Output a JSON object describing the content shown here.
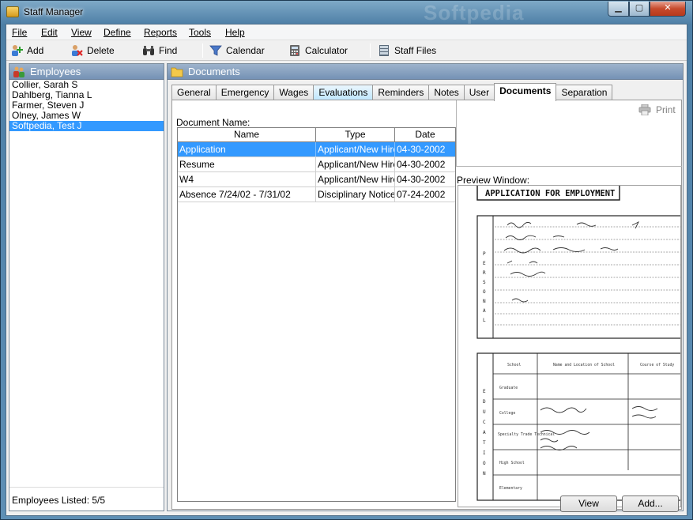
{
  "window": {
    "title": "Staff Manager",
    "watermark": "Softpedia"
  },
  "menu": [
    {
      "id": "file",
      "label": "File"
    },
    {
      "id": "edit",
      "label": "Edit"
    },
    {
      "id": "view",
      "label": "View"
    },
    {
      "id": "define",
      "label": "Define"
    },
    {
      "id": "reports",
      "label": "Reports"
    },
    {
      "id": "tools",
      "label": "Tools"
    },
    {
      "id": "help",
      "label": "Help"
    }
  ],
  "toolbar": {
    "add": "Add",
    "delete": "Delete",
    "find": "Find",
    "calendar": "Calendar",
    "calculator": "Calculator",
    "staff_files": "Staff Files"
  },
  "employees": {
    "header": "Employees",
    "items": [
      "Collier, Sarah S",
      "Dahlberg, Tianna L",
      "Farmer, Steven J",
      "Olney, James W",
      "Softpedia, Test J"
    ],
    "selected_index": 4,
    "footer": "Employees Listed: 5/5"
  },
  "documents": {
    "header": "Documents",
    "tabs": [
      "General",
      "Emergency",
      "Wages",
      "Evaluations",
      "Reminders",
      "Notes",
      "User",
      "Documents",
      "Separation"
    ],
    "active_tab": 7,
    "doc_name_label": "Document Name:",
    "columns": [
      "Name",
      "Type",
      "Date"
    ],
    "rows": [
      {
        "name": "Application",
        "type": "Applicant/New Hire",
        "date": "04-30-2002"
      },
      {
        "name": "Resume",
        "type": "Applicant/New Hire",
        "date": "04-30-2002"
      },
      {
        "name": "W4",
        "type": "Applicant/New Hire",
        "date": "04-30-2002"
      },
      {
        "name": "Absence 7/24/02 - 7/31/02",
        "type": "Disciplinary Notices",
        "date": "07-24-2002"
      }
    ],
    "selected_row": 0,
    "print_label": "Print",
    "preview_label": "Preview Window:",
    "view_button": "View",
    "add_button": "Add..."
  },
  "preview_doc": {
    "title": "APPLICATION FOR EMPLOYMENT",
    "personal_letters": "PERSONAL",
    "education_letters": "EDUCATION",
    "edu_headers": [
      "School",
      "Name and Location of School",
      "Course of Study"
    ],
    "edu_rows": [
      "Graduate",
      "College",
      "Specialty Trade Technical",
      "High School",
      "Elementary"
    ]
  }
}
